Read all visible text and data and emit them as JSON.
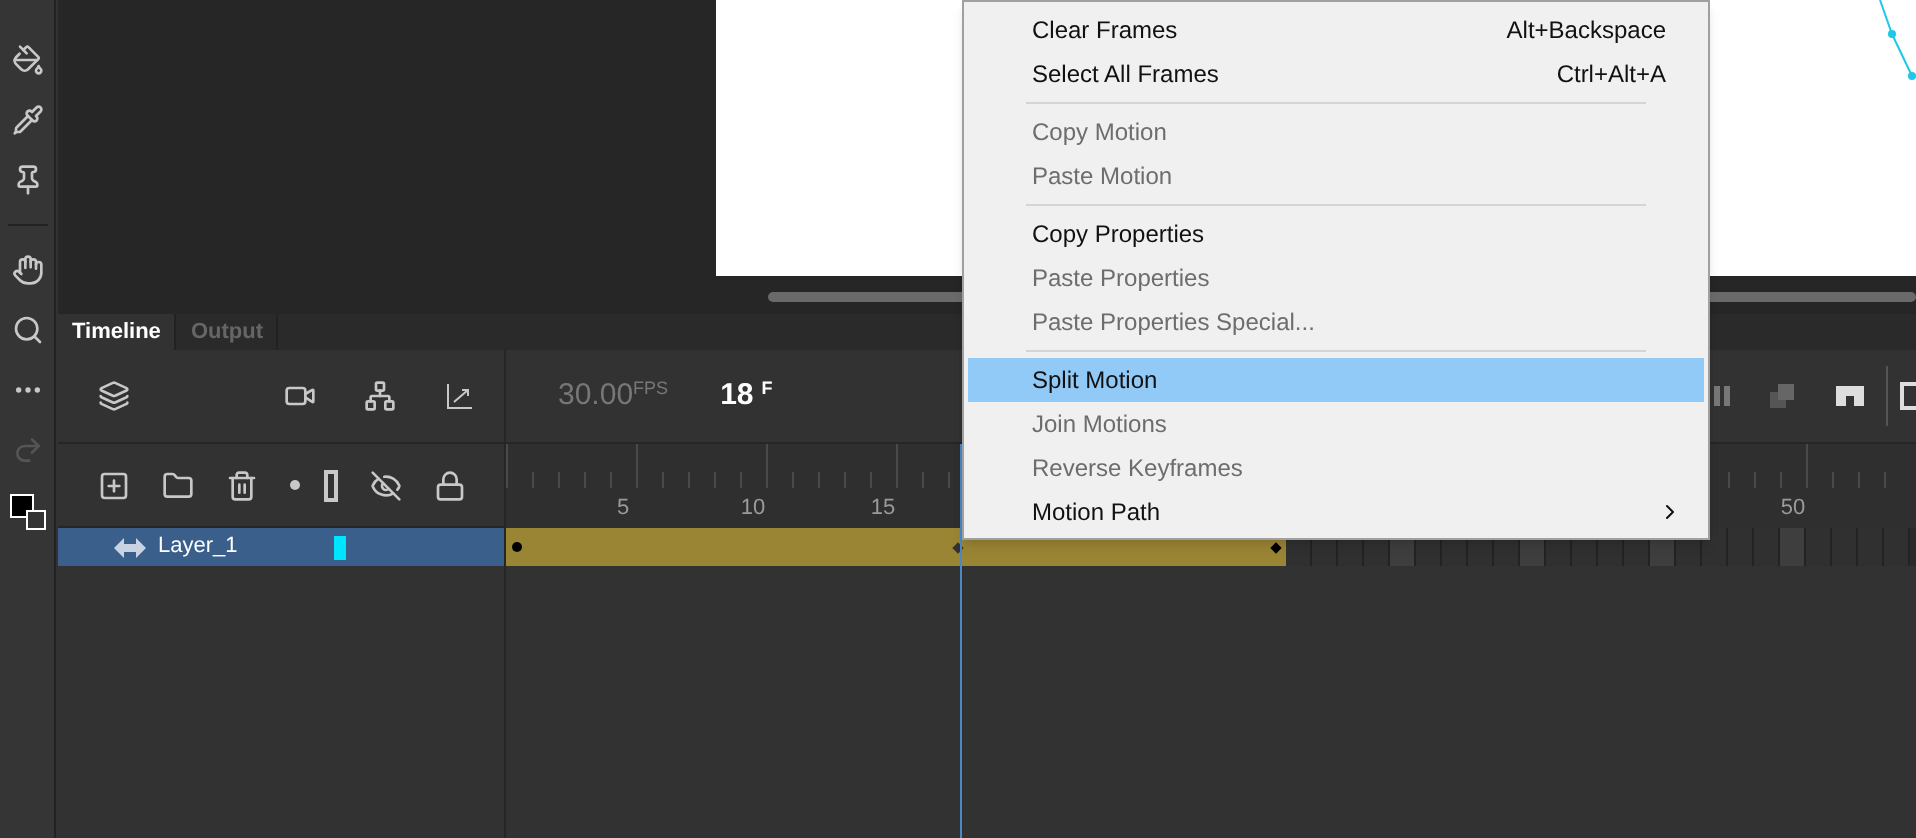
{
  "panel_tabs": [
    {
      "label": "Timeline",
      "selected": true
    },
    {
      "label": "Output",
      "selected": false
    }
  ],
  "timeline": {
    "fps": {
      "value": "30.00",
      "unit": "FPS"
    },
    "current_frame": {
      "value": "18",
      "unit": "F"
    },
    "ruler_labels": [
      "5",
      "10",
      "15",
      "50"
    ],
    "layers": [
      {
        "name": "Layer_1",
        "selected": true,
        "color": "#00e5ff"
      }
    ]
  },
  "context_menu": [
    {
      "kind": "item",
      "label": "Clear Frames",
      "shortcut": "Alt+Backspace",
      "disabled": false,
      "selected": false
    },
    {
      "kind": "item",
      "label": "Select All Frames",
      "shortcut": "Ctrl+Alt+A",
      "disabled": false,
      "selected": false
    },
    {
      "kind": "separator"
    },
    {
      "kind": "item",
      "label": "Copy Motion",
      "disabled": true,
      "selected": false
    },
    {
      "kind": "item",
      "label": "Paste Motion",
      "disabled": true,
      "selected": false
    },
    {
      "kind": "separator"
    },
    {
      "kind": "item",
      "label": "Copy Properties",
      "disabled": false,
      "selected": false
    },
    {
      "kind": "item",
      "label": "Paste Properties",
      "disabled": true,
      "selected": false
    },
    {
      "kind": "item",
      "label": "Paste Properties Special...",
      "disabled": true,
      "selected": false
    },
    {
      "kind": "separator"
    },
    {
      "kind": "item",
      "label": "Split Motion",
      "disabled": false,
      "selected": true
    },
    {
      "kind": "item",
      "label": "Join Motions",
      "disabled": true,
      "selected": false
    },
    {
      "kind": "item",
      "label": "Reverse Keyframes",
      "disabled": true,
      "selected": false
    },
    {
      "kind": "submenu",
      "label": "Motion Path",
      "disabled": false,
      "selected": false
    }
  ]
}
